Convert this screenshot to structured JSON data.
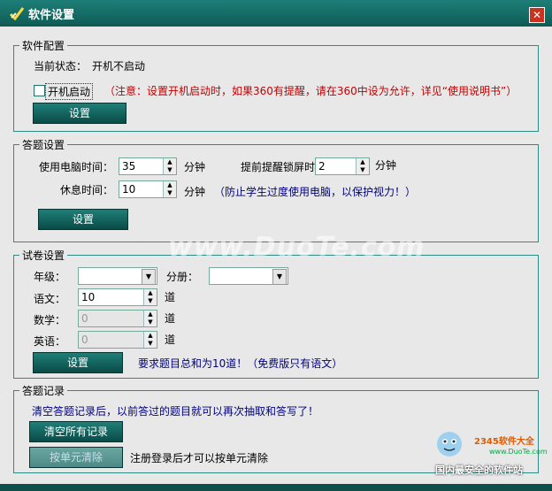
{
  "window": {
    "title": "软件设置"
  },
  "software_config": {
    "legend": "软件配置",
    "status_label": "当前状态：",
    "status_value": "开机不启动",
    "autostart_label": "开机启动",
    "note": "（注意：设置开机启动时，如果360有提醒，请在360中设为允许，详见“使用说明书”）",
    "set_button": "设置"
  },
  "answer_settings": {
    "legend": "答题设置",
    "use_time_label": "使用电脑时间：",
    "use_time_value": "35",
    "use_time_unit": "分钟",
    "remind_label": "提前提醒锁屏时间：",
    "remind_value": "2",
    "remind_unit": "分钟",
    "rest_label": "休息时间：",
    "rest_value": "10",
    "rest_unit": "分钟",
    "rest_note": "（防止学生过度使用电脑，以保护视力！）",
    "set_button": "设置"
  },
  "paper_settings": {
    "legend": "试卷设置",
    "grade_label": "年级：",
    "grade_value": "",
    "volume_label": "分册：",
    "volume_value": "",
    "chinese_label": "语文：",
    "chinese_value": "10",
    "chinese_unit": "道",
    "math_label": "数学：",
    "math_value": "0",
    "math_unit": "道",
    "english_label": "英语：",
    "english_value": "0",
    "english_unit": "道",
    "set_button": "设置",
    "note": "要求题目总和为10道！（免费版只有语文）"
  },
  "records": {
    "legend": "答题记录",
    "desc": "清空答题记录后，以前答过的题目就可以再次抽取和答写了！",
    "clear_all_button": "清空所有记录",
    "clear_unit_button": "按单元清除",
    "clear_unit_note": "注册登录后才可以按单元清除"
  },
  "watermark": "www.DuoTe.com",
  "brand": {
    "name": "2345软件大全",
    "url": "www.DuoTe.com",
    "slogan": "国内最安全的软件站"
  }
}
